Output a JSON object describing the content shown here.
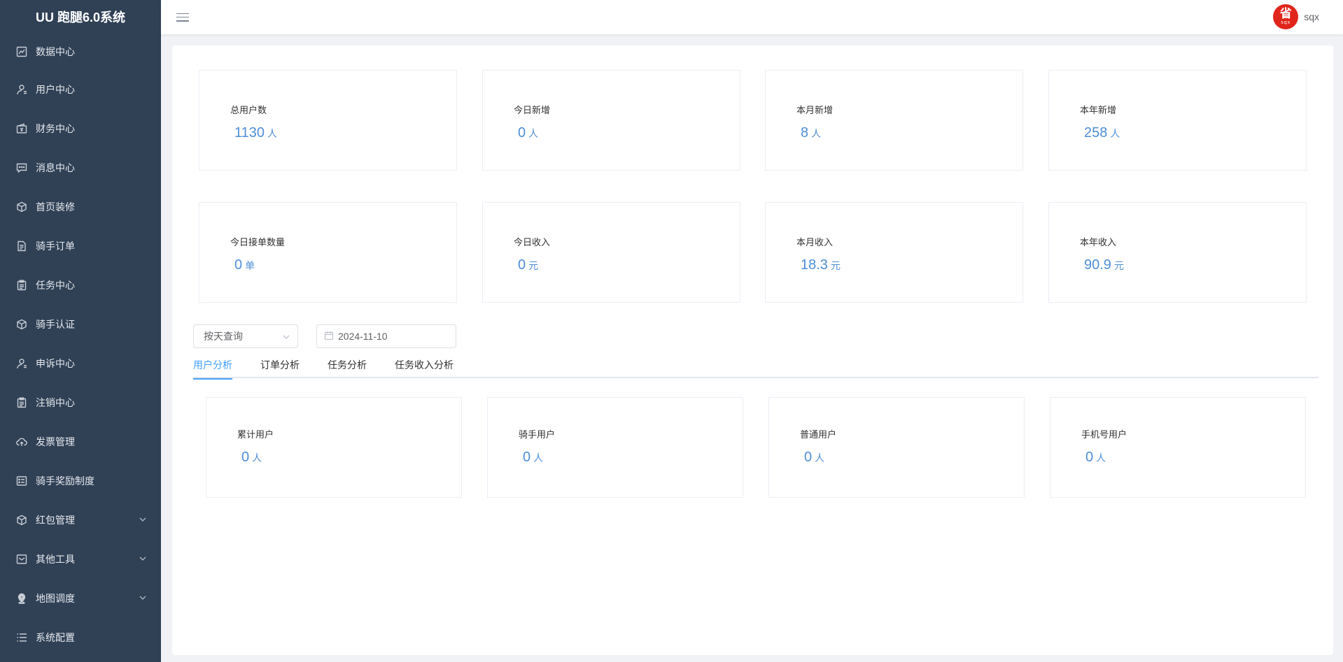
{
  "app": {
    "title": "UU 跑腿6.0系统"
  },
  "sidebar": {
    "items": [
      {
        "label": "数据中心",
        "icon": "chart-line-icon",
        "expandable": false
      },
      {
        "label": "用户中心",
        "icon": "user-icon",
        "expandable": false
      },
      {
        "label": "财务中心",
        "icon": "wallet-icon",
        "expandable": false
      },
      {
        "label": "消息中心",
        "icon": "message-icon",
        "expandable": false
      },
      {
        "label": "首页装修",
        "icon": "box-icon",
        "expandable": false
      },
      {
        "label": "骑手订单",
        "icon": "document-icon",
        "expandable": false
      },
      {
        "label": "任务中心",
        "icon": "clipboard-icon",
        "expandable": false
      },
      {
        "label": "骑手认证",
        "icon": "box-icon",
        "expandable": false
      },
      {
        "label": "申诉中心",
        "icon": "user-icon",
        "expandable": false
      },
      {
        "label": "注销中心",
        "icon": "clipboard-icon",
        "expandable": false
      },
      {
        "label": "发票管理",
        "icon": "cloud-upload-icon",
        "expandable": false
      },
      {
        "label": "骑手奖励制度",
        "icon": "list-card-icon",
        "expandable": false
      },
      {
        "label": "红包管理",
        "icon": "box-icon",
        "expandable": true
      },
      {
        "label": "其他工具",
        "icon": "mail-icon",
        "expandable": true
      },
      {
        "label": "地图调度",
        "icon": "location-icon",
        "expandable": true
      },
      {
        "label": "系统配置",
        "icon": "list-icon",
        "expandable": false
      }
    ]
  },
  "header": {
    "avatar_text": "省",
    "avatar_subtext": "sqx",
    "username": "sqx"
  },
  "stats": [
    {
      "label": "总用户数",
      "value": "1130",
      "unit": "人"
    },
    {
      "label": "今日新增",
      "value": "0",
      "unit": "人"
    },
    {
      "label": "本月新增",
      "value": "8",
      "unit": "人"
    },
    {
      "label": "本年新增",
      "value": "258",
      "unit": "人"
    },
    {
      "label": "今日接单数量",
      "value": "0",
      "unit": "单"
    },
    {
      "label": "今日收入",
      "value": "0",
      "unit": "元"
    },
    {
      "label": "本月收入",
      "value": "18.3",
      "unit": "元"
    },
    {
      "label": "本年收入",
      "value": "90.9",
      "unit": "元"
    }
  ],
  "filters": {
    "query_mode": "按天查询",
    "date": "2024-11-10"
  },
  "tabs": [
    {
      "label": "用户分析",
      "active": true
    },
    {
      "label": "订单分析",
      "active": false
    },
    {
      "label": "任务分析",
      "active": false
    },
    {
      "label": "任务收入分析",
      "active": false
    }
  ],
  "user_analysis": [
    {
      "label": "累计用户",
      "value": "0",
      "unit": "人"
    },
    {
      "label": "骑手用户",
      "value": "0",
      "unit": "人"
    },
    {
      "label": "普通用户",
      "value": "0",
      "unit": "人"
    },
    {
      "label": "手机号用户",
      "value": "0",
      "unit": "人"
    }
  ],
  "colors": {
    "sidebar_bg": "#304156",
    "accent": "#409eff",
    "value_color": "#4e8ed6",
    "avatar_bg": "#e1251b"
  }
}
